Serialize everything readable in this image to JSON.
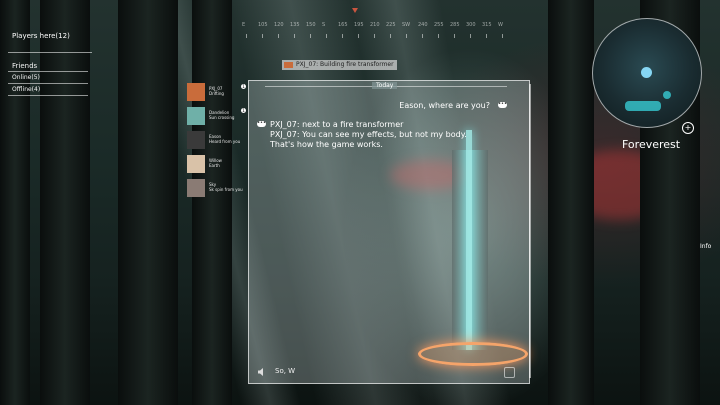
{
  "hud": {
    "players_header": "Players here(12)",
    "friends_label": "Friends",
    "online_label": "Online(5)",
    "offline_label": "Offline(4)",
    "zone_name": "Foreverest",
    "info_label": "Info"
  },
  "compass": {
    "labels": [
      "E",
      "105",
      "120",
      "135",
      "150",
      "S",
      "165",
      "195",
      "210",
      "225",
      "SW",
      "240",
      "255",
      "285",
      "300",
      "315",
      "W"
    ]
  },
  "friends_list": [
    {
      "name": "PXJ_07",
      "status": "Drifting",
      "badge": "1"
    },
    {
      "name": "Dandelion",
      "status": "Sun crossing",
      "badge": "1"
    },
    {
      "name": "Eason",
      "status": "Heard from you",
      "badge": ""
    },
    {
      "name": "Willow",
      "status": "Earth",
      "badge": ""
    },
    {
      "name": "Sky",
      "status": "Sk spin from you",
      "badge": ""
    }
  ],
  "chat": {
    "title": "PXJ_07: Building fire transformer",
    "day_divider": "Today",
    "self_message": "Eason, where are you?",
    "messages": [
      {
        "sender": "PXJ_07",
        "text": "next to a fire transformer"
      },
      {
        "sender": "PXJ_07",
        "text": "You can see my effects, but not my body. That's how the game works."
      }
    ],
    "input_value": "So, W"
  },
  "colors": {
    "accent_orange": "#c96c3b",
    "map_cyan": "#3be0e8",
    "foliage_red": "#be3737"
  }
}
